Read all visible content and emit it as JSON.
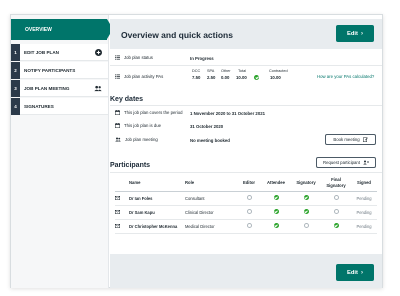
{
  "sidebar": {
    "overview_label": "OVERVIEW",
    "items": [
      {
        "num": "1",
        "label": "EDIT JOB PLAN",
        "icon": "plus-circle-icon"
      },
      {
        "num": "2",
        "label": "NOTIFY PARTICIPANTS",
        "icon": ""
      },
      {
        "num": "3",
        "label": "JOB PLAN MEETING",
        "icon": "people-icon"
      },
      {
        "num": "4",
        "label": "SIGNATURES",
        "icon": ""
      }
    ]
  },
  "header": {
    "title": "Overview and quick actions",
    "edit_label": "Edit"
  },
  "status": {
    "status_label": "Job plan status",
    "status_value": "In Progress",
    "pas_label": "Job plan activity PAs",
    "pa_headers": [
      "DCC",
      "SPA",
      "Other",
      "Total",
      "Contracted"
    ],
    "pa_values": [
      "7.50",
      "2.50",
      "0.00",
      "10.00",
      "10.00"
    ],
    "pa_link": "How are your PAs calculated?"
  },
  "key_dates": {
    "title": "Key dates",
    "rows": [
      {
        "label": "This job plan covers the period",
        "value": "1 November 2020 to 31 October 2021"
      },
      {
        "label": "This job plan is due",
        "value": "31 October 2020"
      },
      {
        "label": "Job plan meeting",
        "value": "No meeting booked"
      }
    ],
    "book_meeting_label": "Book meeting"
  },
  "participants": {
    "title": "Participants",
    "request_label": "Request participant",
    "columns": [
      "Name",
      "Role",
      "Editor",
      "Attendee",
      "Signatory",
      "Final Signatory",
      "Signed"
    ],
    "rows": [
      {
        "name": "Dr Ian Foles",
        "role": "Consultant",
        "editor": false,
        "attendee": true,
        "signatory": true,
        "final": false,
        "signed": "Pending"
      },
      {
        "name": "Dr Sam Kapu",
        "role": "Clinical Director",
        "editor": false,
        "attendee": true,
        "signatory": true,
        "final": false,
        "signed": "Pending"
      },
      {
        "name": "Dr Christopher McKenna",
        "role": "Medical Director",
        "editor": false,
        "attendee": true,
        "signatory": false,
        "final": true,
        "signed": "Pending"
      }
    ]
  },
  "footer": {
    "edit_label": "Edit"
  },
  "colors": {
    "accent": "#00756a",
    "nav_dark": "#2b3a4a",
    "check": "#2aa32a",
    "band": "#e8ecef"
  }
}
